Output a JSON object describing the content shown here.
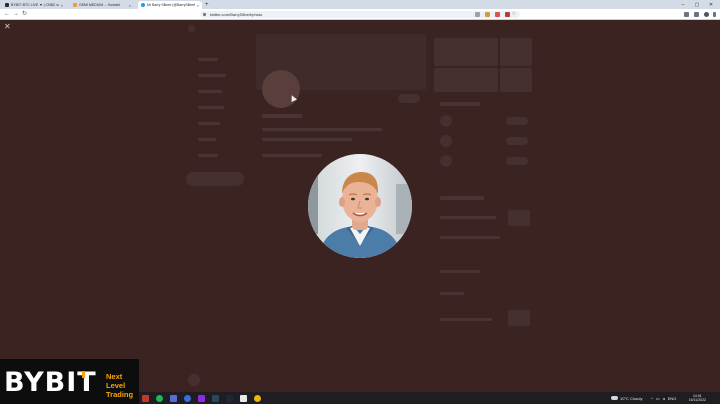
{
  "browser": {
    "tabs": [
      {
        "title": "BYBIT: BTC LIVE ▼ | CNBC sold...",
        "active": false,
        "color": "#2d2d2d"
      },
      {
        "title": "GEMI MEDIUM ... Kontakt",
        "active": false,
        "color": "#e6a03c"
      },
      {
        "title": "Mr Barry Silbert (@BarrySilbert)",
        "active": true,
        "color": "#1d9bf0"
      }
    ],
    "new_tab_icon": "plus-icon",
    "url": "twitter.com/BarrySilbert/photo",
    "window_controls": [
      "minimize-icon",
      "maximize-icon",
      "close-icon"
    ]
  },
  "viewer": {
    "close_icon": "close-icon",
    "avatar_alt": "Profile photo"
  },
  "banner": {
    "logo_text": "BYB",
    "logo_mark": "I",
    "logo_end": "T",
    "tagline": [
      "Next",
      "Level",
      "Trading"
    ],
    "accent": "#f7a600"
  },
  "taskbar": {
    "weather": "10°C  Cloudy",
    "time": "14:01",
    "date": "16/11/2022",
    "lang": "ENG"
  },
  "colors": {
    "overlay": "#3a2322",
    "twitter_blue": "#1d9bf0",
    "taskbar": "#1f1c22"
  }
}
